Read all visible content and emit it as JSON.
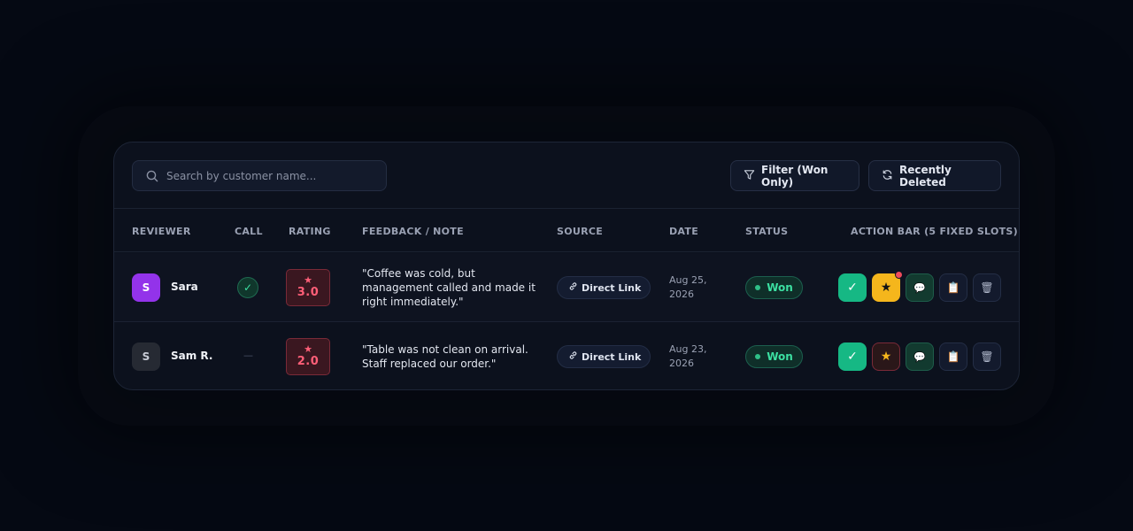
{
  "toolbar": {
    "search_placeholder": "Search by customer name...",
    "filter_label": "Filter (Won Only)",
    "deleted_label": "Recently Deleted"
  },
  "columns": {
    "reviewer": "REVIEWER",
    "call": "CALL",
    "rating": "RATING",
    "feedback": "FEEDBACK / NOTE",
    "source": "SOURCE",
    "date": "DATE",
    "status": "STATUS",
    "actions": "ACTION BAR (5 FIXED SLOTS)"
  },
  "rows": [
    {
      "initial": "S",
      "name": "Sara",
      "called": true,
      "call_empty": "",
      "rating_star": "★",
      "rating": "3.0",
      "feedback": "\"Coffee was cold, but management called and made it right immediately.\"",
      "source": "Direct Link",
      "date_line1": "Aug 25,",
      "date_line2": "2026",
      "status": "Won",
      "starred": true,
      "has_notification": true
    },
    {
      "initial": "S",
      "name": "Sam R.",
      "called": false,
      "call_empty": "—",
      "rating_star": "★",
      "rating": "2.0",
      "feedback": "\"Table was not clean on arrival. Staff replaced our order.\"",
      "source": "Direct Link",
      "date_line1": "Aug 23,",
      "date_line2": "2026",
      "status": "Won",
      "starred": false,
      "has_notification": false
    }
  ],
  "icons": {
    "approve": "✓",
    "star": "★",
    "chat": "💬",
    "note": "📋",
    "trash": "🗑"
  },
  "colors": {
    "accent_green": "#16b884",
    "star_yellow": "#f5b61c",
    "rating_red": "#ff5f78",
    "avatar_purple": "#9333ea"
  }
}
